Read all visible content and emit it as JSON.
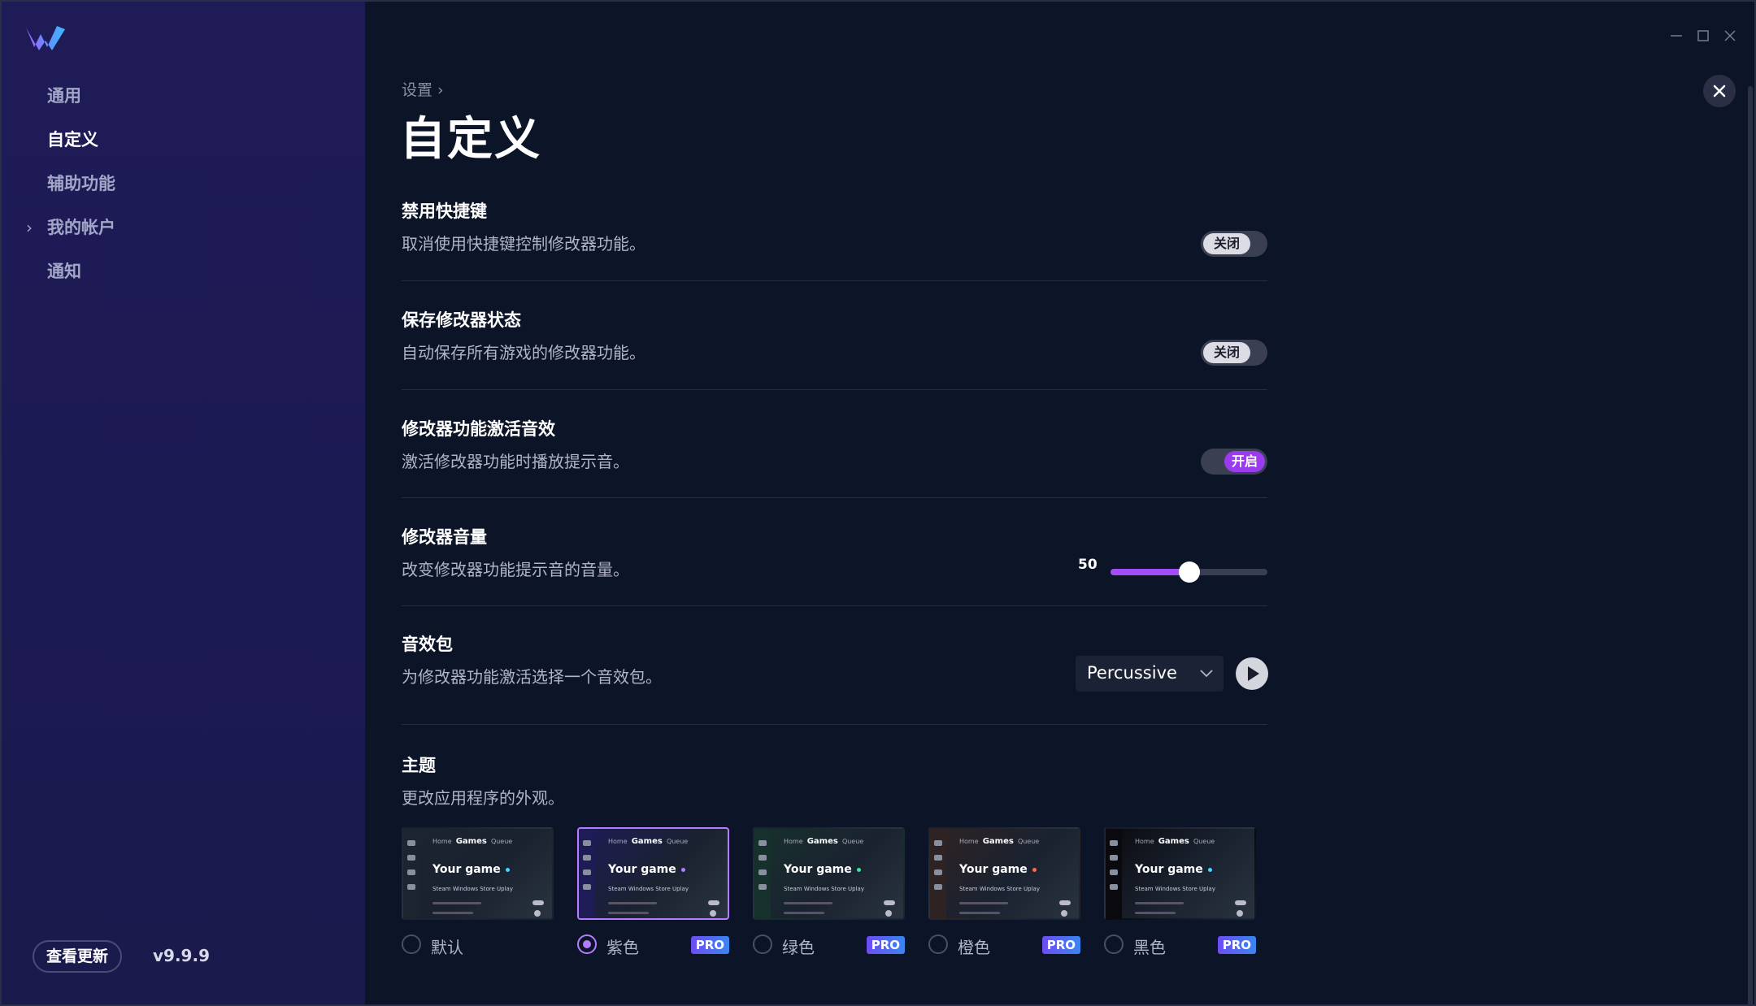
{
  "sidebar": {
    "items": [
      {
        "label": "通用"
      },
      {
        "label": "自定义"
      },
      {
        "label": "辅助功能"
      },
      {
        "label": "我的帐户"
      },
      {
        "label": "通知"
      }
    ],
    "update_label": "查看更新",
    "version": "v9.9.9"
  },
  "main": {
    "breadcrumb": "设置 ›",
    "title": "自定义",
    "settings": {
      "hotkeys": {
        "title": "禁用快捷键",
        "desc": "取消使用快捷键控制修改器功能。",
        "state": "关闭"
      },
      "save_state": {
        "title": "保存修改器状态",
        "desc": "自动保存所有游戏的修改器功能。",
        "state": "关闭"
      },
      "sound": {
        "title": "修改器功能激活音效",
        "desc": "激活修改器功能时播放提示音。",
        "state": "开启"
      },
      "volume": {
        "title": "修改器音量",
        "desc": "改变修改器功能提示音的音量。",
        "value": "50",
        "percent": 50
      },
      "sound_pack": {
        "title": "音效包",
        "desc": "为修改器功能激活选择一个音效包。",
        "selected": "Percussive"
      },
      "theme": {
        "title": "主题",
        "desc": "更改应用程序的外观。"
      }
    },
    "theme_preview": {
      "nav": [
        "Home",
        "Games",
        "Queue"
      ],
      "game": "Your game",
      "platforms": "Steam   Windows Store   Uplay"
    },
    "themes": [
      {
        "name": "默认",
        "pro": "",
        "checked": false,
        "accent": "#4cd3ff",
        "side": "#1c2430"
      },
      {
        "name": "紫色",
        "pro": "PRO",
        "checked": true,
        "accent": "#b77bff",
        "side": "#1e1b57"
      },
      {
        "name": "绿色",
        "pro": "PRO",
        "checked": false,
        "accent": "#3fe0a0",
        "side": "#16312c"
      },
      {
        "name": "橙色",
        "pro": "PRO",
        "checked": false,
        "accent": "#ff6a4d",
        "side": "#2e2322"
      },
      {
        "name": "黑色",
        "pro": "PRO",
        "checked": false,
        "accent": "#4cd3ff",
        "side": "#0a0a0e"
      }
    ]
  },
  "colors": {
    "accent": "#a24ef7",
    "sidebar_bg": "#1e1b57",
    "main_bg": "#0c1427"
  }
}
